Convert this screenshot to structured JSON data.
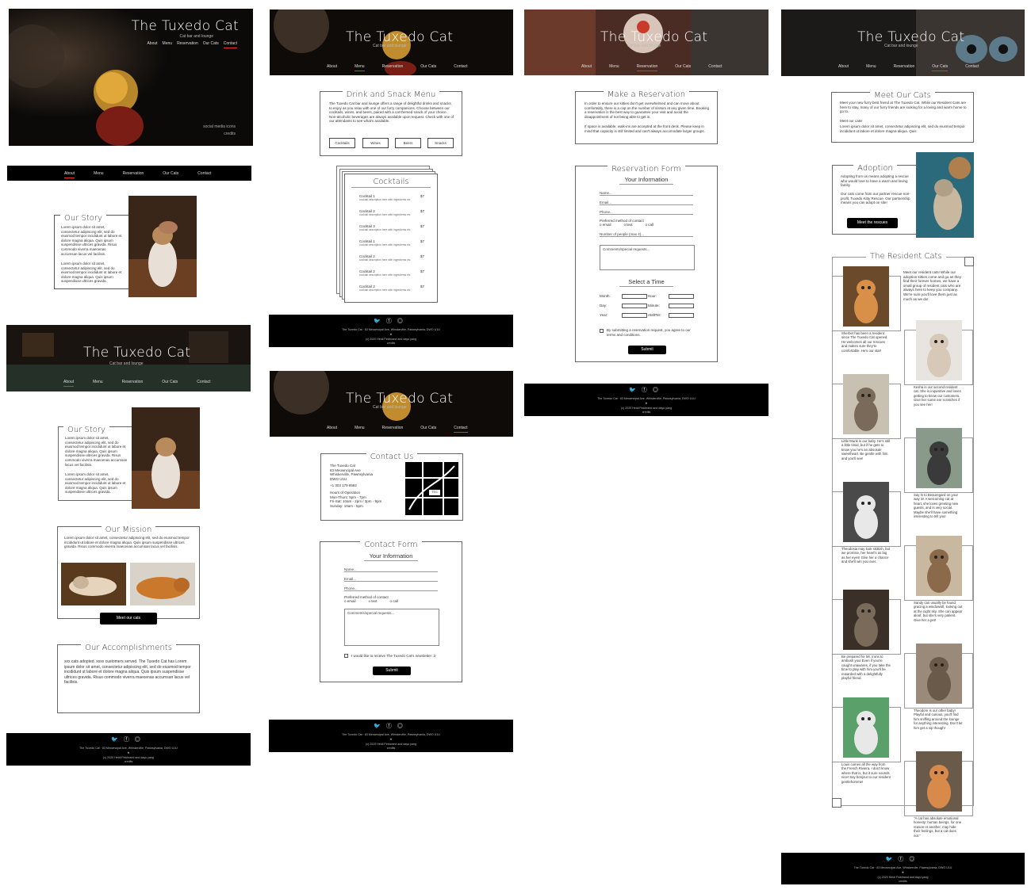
{
  "brand": {
    "title": "The Tuxedo Cat",
    "tagline": "Cat bar and lounge",
    "accent": "#d33333",
    "dark": "#000000"
  },
  "nav": [
    "About",
    "Menu",
    "Reservation",
    "Our Cats",
    "Contact"
  ],
  "hero_social": [
    "social media icons",
    "credits"
  ],
  "about_v1": {
    "story_title": "Our Story",
    "story_p1": "Lorem ipsum dolor sit amet, consectetur adipiscing elit, sed do eiusmod tempor incididunt ut labore et dolore magna aliqua. Quis ipsum suspendisse ultrices gravida. Risus commodo viverra maecenas accumsan lacus vel facilisis.",
    "story_p2": "Lorem ipsum dolor sit amet, consectetur adipiscing elit, sed do eiusmod tempor incididunt ut labore et dolore magna aliqua. Quis ipsum suspendisse ultrices gravida."
  },
  "about_v2": {
    "story_title": "Our Story",
    "mission_title": "Our Mission",
    "mission_text": "Lorem ipsum dolor sit amet, consectetur adipiscing elit, sed do eiusmod tempor incididunt ut labore et dolore magna aliqua. Quis ipsum suspendisse ultrices gravida. Risus commodo viverra maecenas accumsan lacus vel facilisis.",
    "meet_button": "Meet our cats",
    "accomplishments_title": "Our Accomplishments",
    "accomplishments_text": "xxx cats adopted. xxxx customers served. The Tuxedo Cat has Lorem ipsum dolor sit amet, consectetur adipiscing elit, sed do eiusmod tempor incididunt ut labore et dolore magna aliqua. Quis ipsum suspendisse ultrices gravida. Risus commodo viverra maecenas accumsan lacus vel facilisis."
  },
  "menu_page": {
    "title": "Drink and Snack Menu",
    "intro": "The Tuxedo Cat bar and lounge offers a range of delightful drinks and snacks to enjoy as you relax with one of our furry companions. Choose between our cocktails, wines, and beers, paired with a cat themed snack of your choice. Non-alcoholic beverages are always available upon request. Check with one of our attendants to see what's available.",
    "categories": [
      "Cocktails",
      "Wines",
      "Beers",
      "Snacks"
    ],
    "card_title": "Cocktails",
    "items": [
      {
        "name": "Cocktail 1",
        "desc": "cocktail description here with ingredients etc",
        "price": "$7"
      },
      {
        "name": "Cocktail 2",
        "desc": "cocktail description here with ingredients etc",
        "price": "$7"
      },
      {
        "name": "Cocktail 3",
        "desc": "cocktail description here with ingredients etc",
        "price": "$7"
      },
      {
        "name": "Cocktail 1",
        "desc": "cocktail description here with ingredients etc",
        "price": "$7"
      },
      {
        "name": "Cocktail 2",
        "desc": "cocktail description here with ingredients etc",
        "price": "$7"
      },
      {
        "name": "Cocktail 2",
        "desc": "cocktail description here with ingredients etc",
        "price": "$7"
      },
      {
        "name": "Cocktail 2",
        "desc": "cocktail description here with ingredients etc",
        "price": "$7"
      }
    ]
  },
  "contact_page": {
    "title": "Contact Us",
    "address": [
      "The Tuxedo Cat",
      "83 Meowncipal Ave",
      "Whiskerville, Pawnsylvania",
      "DWO U1U"
    ],
    "phone": "+1 303 179 8582",
    "hours_title": "Hours of Operation",
    "hours": [
      "Mon-Thurs: 5pm - 7pm",
      "Fri-Sat: 10am - 2pm / 3pm - 9pm",
      "Sunday: 10am - 5pm"
    ],
    "map_badge": "TTC",
    "form_title": "Contact Form",
    "form_subtitle": "Your Information",
    "fields": [
      "Name",
      "Email",
      "Phone"
    ],
    "pref_label": "Preferred method of contact",
    "pref_options": [
      "o email",
      "o text",
      "o call"
    ],
    "comments_placeholder": "Comments/special requests...",
    "newsletter": "I would like to receive The Tuxedo Cat's newsletter :3",
    "submit": "Submit"
  },
  "reservation_page": {
    "title": "Make a Reservation",
    "p1": "In order to ensure our kitties don't get overwhelmed and can move about comfortably, there is a cap on the number of visitors at any given time. Booking a reservation is the best way to guarantee your visit and avoid the disappointment of not being able to get in.",
    "p2": "If space is available, walk-ins are accepted at the front desk. Please keep in mind that capacity is still limited and can't always accomodate larger groups.",
    "form_title": "Reservation Form",
    "form_subtitle": "Your Information",
    "fields": [
      "Name",
      "Email",
      "Phone"
    ],
    "pref_label": "Preferred method of contact",
    "pref_options": [
      "o email",
      "o text",
      "o call"
    ],
    "people_label": "Number of people (max 4)",
    "comments_placeholder": "Comments/special requests...",
    "time_title": "Select a Time",
    "time_left": [
      "Month:",
      "Day:",
      "Year:"
    ],
    "time_right": [
      "Hour:",
      "Minute:",
      "AM/PM:"
    ],
    "agree": "By submitting a reservation request, you agree to our terms and conditions.",
    "submit": "Submit"
  },
  "cats_page": {
    "title": "Meet Our Cats",
    "intro": "Meet your new furry best friend at The Tuxedo Cat. While our Resident Cats are here to stay, many of our furry friends are looking for a loving and warm home to go to.",
    "intro2": "Meet our cats!",
    "intro3": "Lorem ipsum dolor sit amet, consectetur adipiscing elit, sed do eiusmod tempor incididunt ut labore et dolore magna aliqua. Quis",
    "adoption_title": "Adoption",
    "adoption_p1": "Adopting from us means adopting a rescue who would love to have a warm and loving family.",
    "adoption_p2": "Our cats come from our partner rescue non-profit, Tuxedo Kitty Rescue. Our partnership means you can adopt on site!",
    "adoption_button": "Meet the rescues",
    "resident_title": "The Resident Cats",
    "resident_intro": "Meet our resident cats! While our adoption kitties come and go as they find their forever homes, we have a small group of resident cats who are always here to keep you company. We're sure you'll love them just as much as we do!",
    "cats": [
      {
        "text": "Sherbet has been a resident since The Tuxedo Cat opened. He welcomes all our rescues and makes sure they're comfortable. He's our star!"
      },
      {
        "text": "Kesha is our second resident cat. She is inquisitive and loves getting to know our customers. Give her some ear scratches if you see her!"
      },
      {
        "text": "Little Munk is our baby. He's still a little timid, but if he gets to know you he's an absolute sweetheart. Be gentle with him and you'll see!"
      },
      {
        "text": "Say hi to Beauregard on your way in! A welcoming cat at heart, she loves greeting new guests, and is very social. Maybe she'll have something interesting to tell you!"
      },
      {
        "text": "Theodosia may look skittish, but we promise, her heart's as big as her eyes! Give her a chance and she'll win you over."
      },
      {
        "text": "Sandy can usually be found gracing a windowsill, looking out at the night sky. She can appear aloof, but she's very patient. Give her a pet!"
      },
      {
        "text": "Be prepared for Mr. Irons to ambush you! Even if you're caught unawares, if you take the time to play with him you'll be rewarded with a delightfully playful friend."
      },
      {
        "text": "Theodore is our other baby! Playful and curious, you'll find him sniffing around the lounge for anything interesting. Don't let him get a sip though!"
      },
      {
        "text": "Louis comes all the way from the French Riviera. I don't know where that is, but it sure sounds nice! Say bonjour to our resident gentlehomme!"
      },
      {
        "text": "\"A cat has absolute emotional honesty: human beings, for one reason or another, may hide their feelings, but a cat does not.\""
      }
    ]
  },
  "footer": {
    "icons": [
      "twitter-icon",
      "facebook-icon",
      "instagram-icon"
    ],
    "line1": "The Tuxedo Cat · 83 Meowncipal Ave, Whiskerville, Pawnsylvania, DWO U1U",
    "line2": "(c) 2020 Heidi Finkbrand and dayu yang",
    "line3": "credits"
  }
}
